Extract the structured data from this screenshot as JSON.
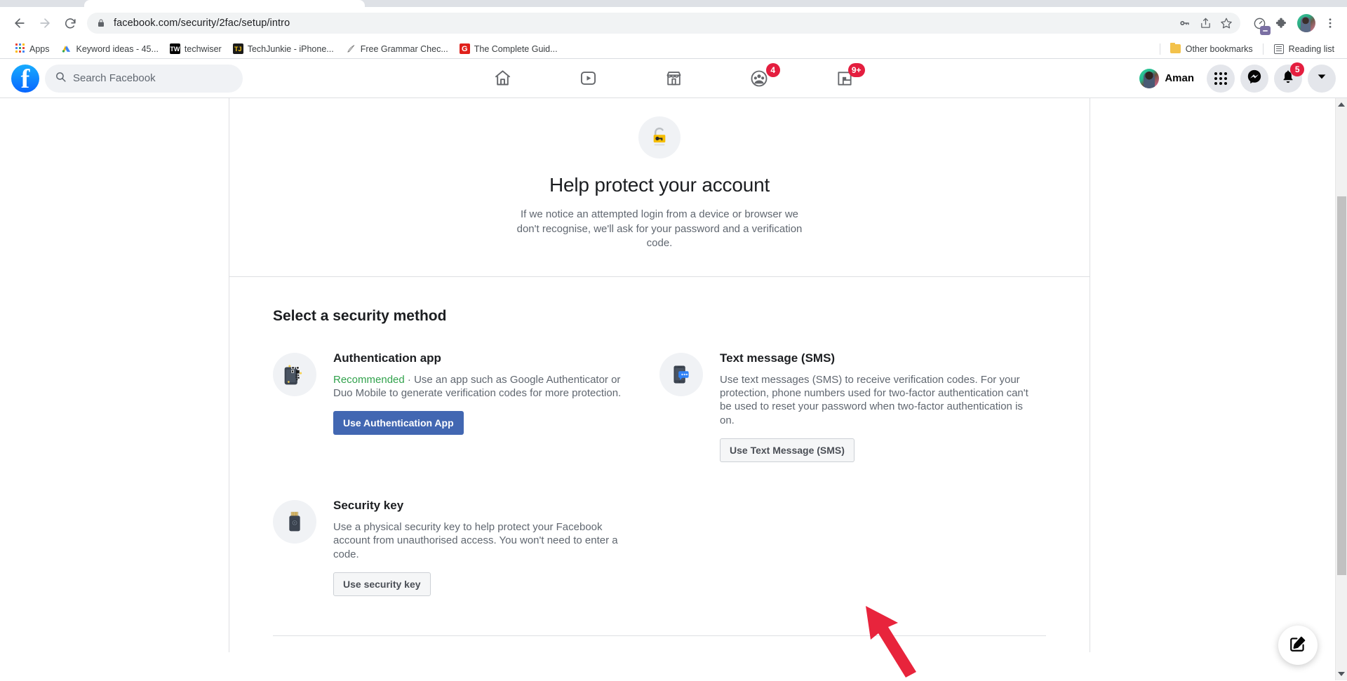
{
  "browser": {
    "nav": {
      "back_label": "Back",
      "forward_label": "Forward",
      "reload_label": "Reload"
    },
    "omnibox": {
      "url": "facebook.com/security/2fac/setup/intro",
      "lock_icon": "lock-icon",
      "icons": [
        "password-key-icon",
        "share-icon",
        "bookmark-star-icon"
      ]
    },
    "toolbar_right": {
      "extension_icon": "extension-puzzle-icon",
      "speedtest_icon": "speed-dial-icon",
      "profile_label": "Chrome profile",
      "menu_label": "Customise and control Google Chrome"
    },
    "bookmarks": [
      {
        "label": "Apps",
        "favicon": "apps-grid-icon"
      },
      {
        "label": "Keyword ideas - 45...",
        "favicon": "google-ads-icon"
      },
      {
        "label": "techwiser",
        "favicon": "techwiser-icon"
      },
      {
        "label": "TechJunkie - iPhone...",
        "favicon": "techjunkie-icon"
      },
      {
        "label": "Free Grammar Chec...",
        "favicon": "grammarly-quill-icon"
      },
      {
        "label": "The Complete Guid...",
        "favicon": "grammarly-g-icon"
      }
    ],
    "bookmarks_right": [
      {
        "label": "Other bookmarks",
        "icon": "folder-icon"
      },
      {
        "label": "Reading list",
        "icon": "reading-list-icon"
      }
    ]
  },
  "facebook_header": {
    "logo_letter": "f",
    "search_placeholder": "Search Facebook",
    "nav_items": [
      {
        "name": "home",
        "icon": "home-icon",
        "badge": ""
      },
      {
        "name": "watch",
        "icon": "video-play-icon",
        "badge": ""
      },
      {
        "name": "marketplace",
        "icon": "storefront-icon",
        "badge": ""
      },
      {
        "name": "groups",
        "icon": "groups-people-icon",
        "badge": "4"
      },
      {
        "name": "gaming",
        "icon": "gaming-icon",
        "badge": "9+"
      }
    ],
    "profile_name": "Aman",
    "right_actions": [
      {
        "name": "menu",
        "icon": "nine-dots-grid-icon",
        "badge": ""
      },
      {
        "name": "messenger",
        "icon": "messenger-icon",
        "badge": ""
      },
      {
        "name": "notifications",
        "icon": "bell-icon",
        "badge": "5"
      },
      {
        "name": "account",
        "icon": "chevron-down-icon",
        "badge": ""
      }
    ]
  },
  "hero": {
    "icon": "unlocked-padlock-key-icon",
    "title": "Help protect your account",
    "description": "If we notice an attempted login from a device or browser we don't recognise, we'll ask for your password and a verification code."
  },
  "methods": {
    "section_title": "Select a security method",
    "items": [
      {
        "id": "authentication-app",
        "icon": "qr-code-phone-icon",
        "title": "Authentication app",
        "recommended_label": "Recommended",
        "separator": " · ",
        "description": "Use an app such as Google Authenticator or Duo Mobile to generate verification codes for more protection.",
        "button_label": "Use Authentication App",
        "button_style": "primary"
      },
      {
        "id": "text-message-sms",
        "icon": "phone-message-bubble-icon",
        "title": "Text message (SMS)",
        "recommended_label": "",
        "separator": "",
        "description": "Use text messages (SMS) to receive verification codes. For your protection, phone numbers used for two-factor authentication can't be used to reset your password when two-factor authentication is on.",
        "button_label": "Use Text Message (SMS)",
        "button_style": "secondary"
      },
      {
        "id": "security-key",
        "icon": "usb-security-key-icon",
        "title": "Security key",
        "recommended_label": "",
        "separator": "",
        "description": "Use a physical security key to help protect your Facebook account from unauthorised access. You won't need to enter a code.",
        "button_label": "Use security key",
        "button_style": "secondary"
      }
    ]
  },
  "annotation": {
    "type": "red-arrow",
    "points_to": "Use Text Message (SMS)",
    "color": "#e8243c"
  },
  "floating_action": {
    "icon": "compose-pencil-icon",
    "label": "Create"
  },
  "colors": {
    "facebook_blue": "#1877f2",
    "button_primary": "#4267b2",
    "recommended_green": "#31a24c",
    "badge_red": "#e41e3f",
    "annotation_red": "#e8243c",
    "text_primary": "#1c1e21",
    "text_secondary": "#606770"
  }
}
